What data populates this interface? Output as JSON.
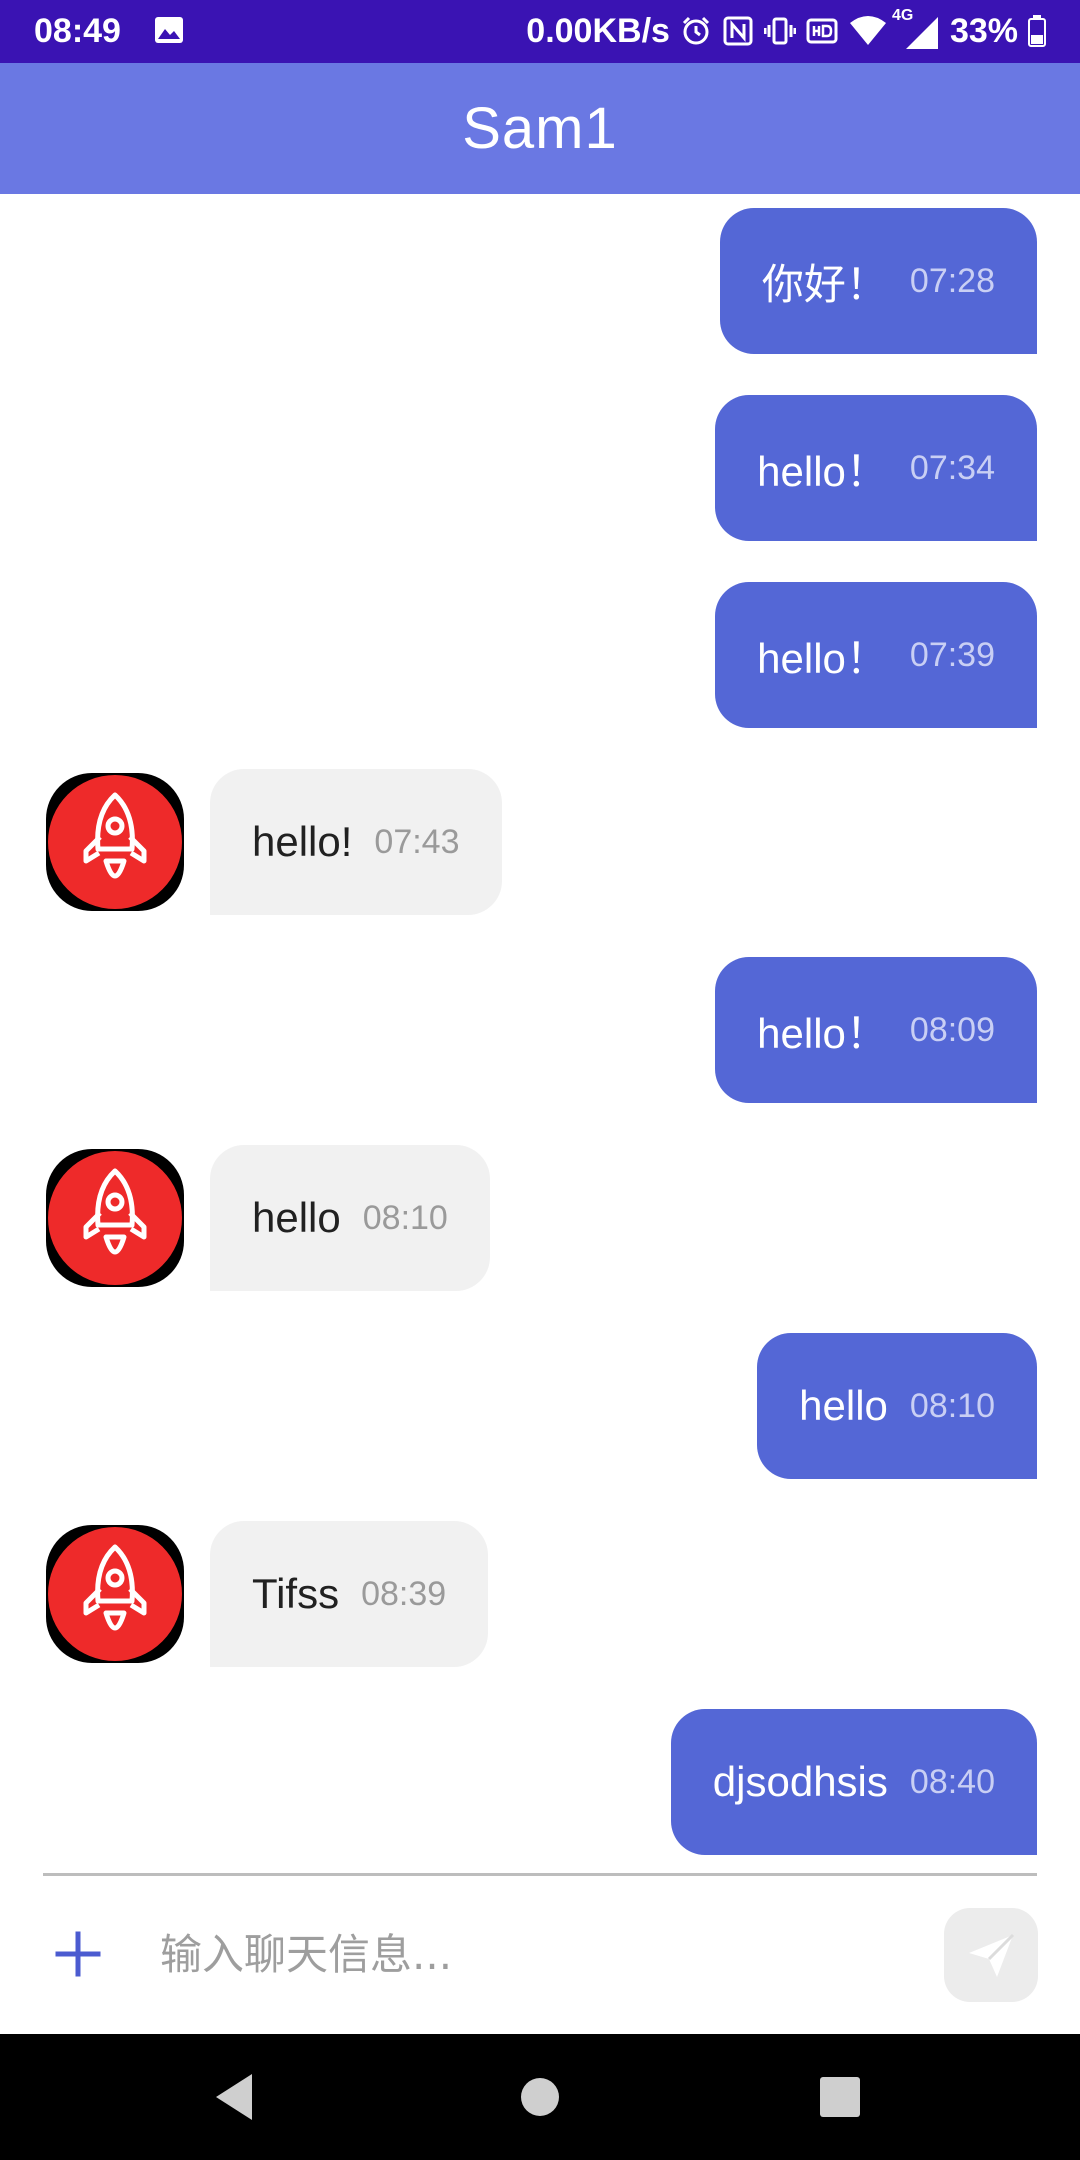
{
  "status_bar": {
    "time": "08:49",
    "net_speed": "0.00KB/s",
    "network_type": "4G",
    "battery": "33%"
  },
  "app_bar": {
    "title": "Sam1"
  },
  "messages": [
    {
      "direction": "out",
      "text": "你好！",
      "time": "07:28"
    },
    {
      "direction": "out",
      "text": "hello！",
      "time": "07:34"
    },
    {
      "direction": "out",
      "text": "hello！",
      "time": "07:39"
    },
    {
      "direction": "in",
      "text": "hello!",
      "time": "07:43"
    },
    {
      "direction": "out",
      "text": "hello！",
      "time": "08:09"
    },
    {
      "direction": "in",
      "text": "hello",
      "time": "08:10"
    },
    {
      "direction": "out",
      "text": "hello",
      "time": "08:10"
    },
    {
      "direction": "in",
      "text": "Tifss",
      "time": "08:39"
    },
    {
      "direction": "out",
      "text": "djsodhsis",
      "time": "08:40"
    }
  ],
  "composer": {
    "placeholder": "输入聊天信息...",
    "value": ""
  },
  "colors": {
    "status_bar": "#3a13b3",
    "app_bar": "#6a78e3",
    "outgoing_bubble": "#5467d6",
    "incoming_bubble": "#f1f1f1",
    "avatar_red": "#ee2a2a"
  },
  "icons": {
    "status": [
      "gallery-icon",
      "alarm-icon",
      "nfc-icon",
      "vibrate-icon",
      "hd-icon",
      "wifi-icon",
      "signal-icon",
      "battery-icon"
    ],
    "avatar": "rocket-icon",
    "composer": [
      "plus-icon",
      "send-icon"
    ],
    "navigation": [
      "back-icon",
      "home-icon",
      "recents-icon"
    ]
  }
}
